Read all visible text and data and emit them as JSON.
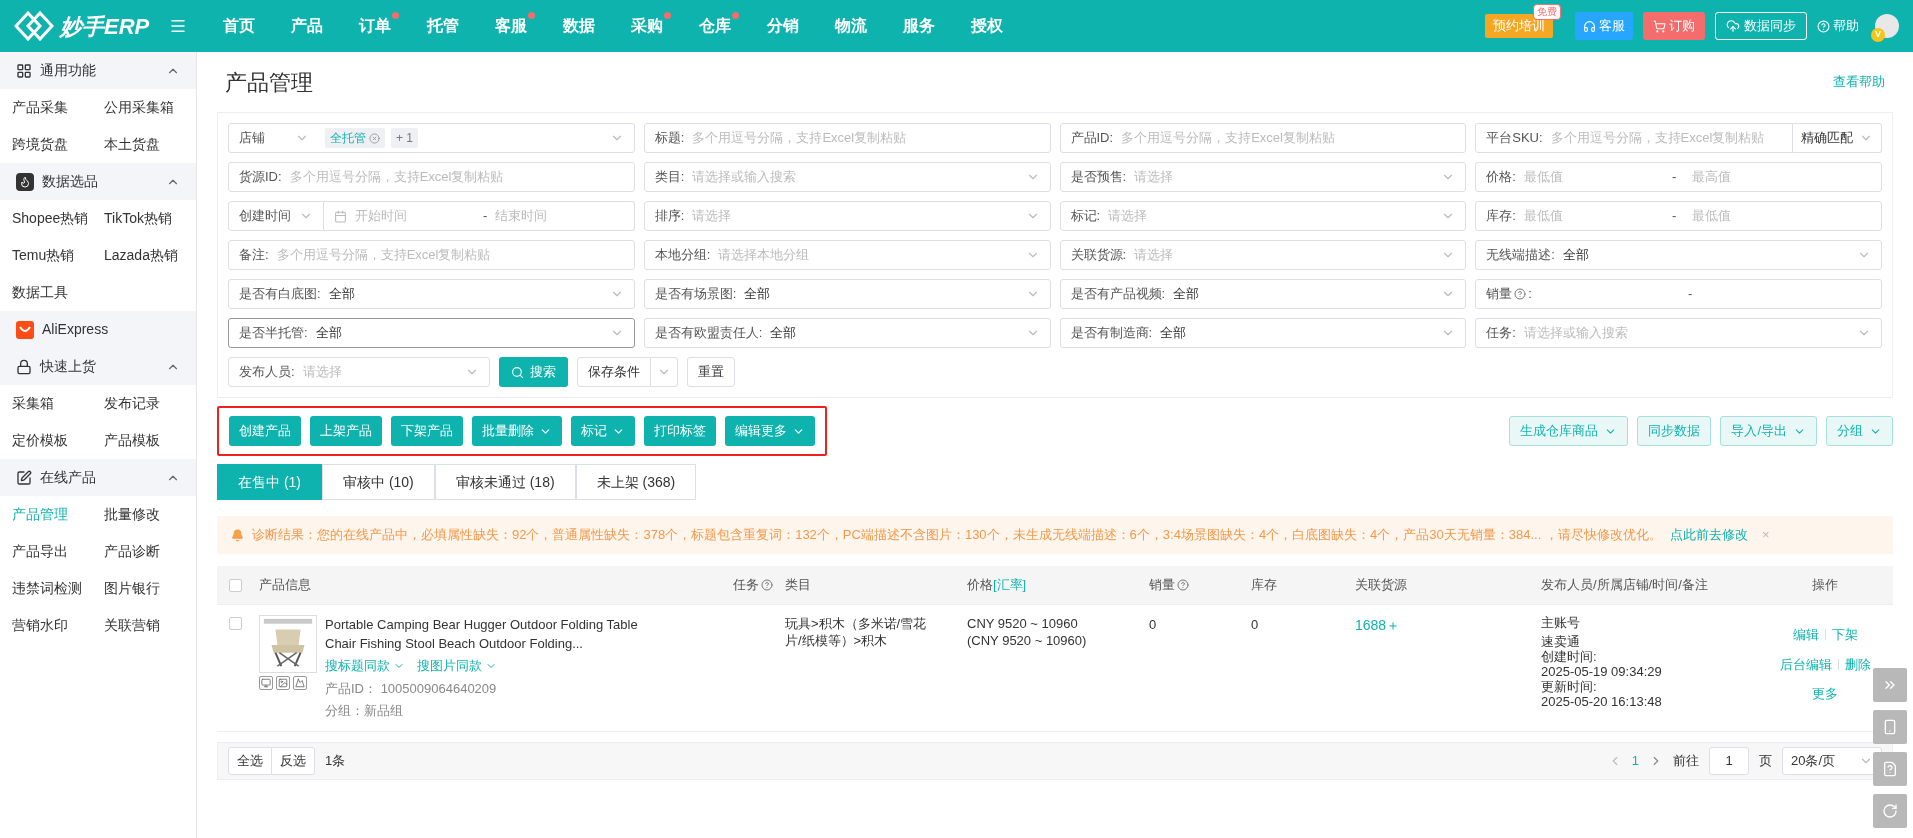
{
  "header": {
    "logo": "妙手ERP",
    "nav": [
      {
        "label": "首页",
        "dot": false
      },
      {
        "label": "产品",
        "dot": false
      },
      {
        "label": "订单",
        "dot": true
      },
      {
        "label": "托管",
        "dot": false
      },
      {
        "label": "客服",
        "dot": true
      },
      {
        "label": "数据",
        "dot": false
      },
      {
        "label": "采购",
        "dot": true
      },
      {
        "label": "仓库",
        "dot": true
      },
      {
        "label": "分销",
        "dot": false
      },
      {
        "label": "物流",
        "dot": false
      },
      {
        "label": "服务",
        "dot": false
      },
      {
        "label": "授权",
        "dot": false
      }
    ],
    "training": "预约培训",
    "training_badge": "免费",
    "service": "客服",
    "order": "订购",
    "sync": "数据同步",
    "help": "帮助",
    "avatar_badge": "V"
  },
  "sidebar": [
    {
      "kind": "group",
      "title": "通用功能",
      "expanded": true,
      "items": [
        {
          "label": "产品采集",
          "selected": false
        },
        {
          "label": "公用采集箱",
          "selected": false
        },
        {
          "label": "跨境货盘",
          "selected": false
        },
        {
          "label": "本土货盘",
          "selected": false
        }
      ]
    },
    {
      "kind": "group",
      "title": "数据选品",
      "expanded": true,
      "items": [
        {
          "label": "Shopee热销",
          "selected": false
        },
        {
          "label": "TikTok热销",
          "selected": false
        },
        {
          "label": "Temu热销",
          "selected": false
        },
        {
          "label": "Lazada热销",
          "selected": false
        },
        {
          "label": "数据工具",
          "selected": false
        }
      ]
    },
    {
      "kind": "link",
      "title": "AliExpress"
    },
    {
      "kind": "group",
      "title": "快速上货",
      "expanded": true,
      "items": [
        {
          "label": "采集箱",
          "selected": false
        },
        {
          "label": "发布记录",
          "selected": false
        },
        {
          "label": "定价模板",
          "selected": false
        },
        {
          "label": "产品模板",
          "selected": false
        }
      ]
    },
    {
      "kind": "group",
      "title": "在线产品",
      "expanded": true,
      "items": [
        {
          "label": "产品管理",
          "selected": true
        },
        {
          "label": "批量修改",
          "selected": false
        },
        {
          "label": "产品导出",
          "selected": false
        },
        {
          "label": "产品诊断",
          "selected": false
        },
        {
          "label": "违禁词检测",
          "selected": false
        },
        {
          "label": "图片银行",
          "selected": false
        },
        {
          "label": "营销水印",
          "selected": false
        },
        {
          "label": "关联营销",
          "selected": false
        }
      ]
    }
  ],
  "page": {
    "title": "产品管理",
    "help_link": "查看帮助"
  },
  "filters": [
    [
      {
        "kind": "tags",
        "label": "店铺",
        "tags": [
          "全托管",
          "+ 1"
        ]
      },
      {
        "kind": "input",
        "label": "标题:",
        "placeholder": "多个用逗号分隔，支持Excel复制粘贴"
      },
      {
        "kind": "input",
        "label": "产品ID:",
        "placeholder": "多个用逗号分隔，支持Excel复制粘贴"
      },
      {
        "kind": "input-match",
        "label": "平台SKU:",
        "placeholder": "多个用逗号分隔，支持Excel复制粘贴",
        "match": "精确匹配"
      }
    ],
    [
      {
        "kind": "input",
        "label": "货源ID:",
        "placeholder": "多个用逗号分隔，支持Excel复制粘贴"
      },
      {
        "kind": "select",
        "label": "类目:",
        "placeholder": "请选择或输入搜索"
      },
      {
        "kind": "select",
        "label": "是否预售:",
        "placeholder": "请选择"
      },
      {
        "kind": "range",
        "label": "价格:",
        "from_placeholder": "最低值",
        "sep": "-",
        "to_placeholder": "最高值"
      }
    ],
    [
      {
        "kind": "daterange",
        "label": "创建时间",
        "start_placeholder": "开始时间",
        "sep": "-",
        "end_placeholder": "结束时间"
      },
      {
        "kind": "select",
        "label": "排序:",
        "placeholder": "请选择"
      },
      {
        "kind": "select",
        "label": "标记:",
        "placeholder": "请选择"
      },
      {
        "kind": "range",
        "label": "库存:",
        "from_placeholder": "最低值",
        "sep": "-",
        "to_placeholder": "最低值"
      }
    ],
    [
      {
        "kind": "input",
        "label": "备注:",
        "placeholder": "多个用逗号分隔，支持Excel复制粘贴"
      },
      {
        "kind": "select",
        "label": "本地分组:",
        "placeholder": "请选择本地分组"
      },
      {
        "kind": "select",
        "label": "关联货源:",
        "placeholder": "请选择"
      },
      {
        "kind": "select",
        "label": "无线端描述:",
        "value": "全部"
      }
    ],
    [
      {
        "kind": "select",
        "label": "是否有白底图:",
        "value": "全部"
      },
      {
        "kind": "select",
        "label": "是否有场景图:",
        "value": "全部"
      },
      {
        "kind": "select",
        "label": "是否有产品视频:",
        "value": "全部"
      },
      {
        "kind": "range",
        "label": "销量",
        "help": true,
        "label_end": ":",
        "sep": "-"
      }
    ],
    [
      {
        "kind": "select",
        "label": "是否半托管:",
        "value": "全部",
        "focused": true
      },
      {
        "kind": "select",
        "label": "是否有欧盟责任人:",
        "value": "全部"
      },
      {
        "kind": "select",
        "label": "是否有制造商:",
        "value": "全部"
      },
      {
        "kind": "select",
        "label": "任务:",
        "placeholder": "请选择或输入搜索"
      }
    ]
  ],
  "filter_actions": {
    "publisher": {
      "label": "发布人员:",
      "placeholder": "请选择"
    },
    "search": "搜索",
    "save": "保存条件",
    "reset": "重置"
  },
  "actions": {
    "highlighted": true,
    "left": [
      {
        "label": "创建产品",
        "dropdown": false
      },
      {
        "label": "上架产品",
        "dropdown": false
      },
      {
        "label": "下架产品",
        "dropdown": false
      },
      {
        "label": "批量删除",
        "dropdown": true
      },
      {
        "label": "标记",
        "dropdown": true
      },
      {
        "label": "打印标签",
        "dropdown": false
      },
      {
        "label": "编辑更多",
        "dropdown": true
      }
    ],
    "right": [
      {
        "label": "生成仓库商品",
        "dropdown": true
      },
      {
        "label": "同步数据",
        "dropdown": false
      },
      {
        "label": "导入/导出",
        "dropdown": true
      },
      {
        "label": "分组",
        "dropdown": true
      }
    ]
  },
  "tabs": [
    {
      "label": "在售中 (1)",
      "selected": true
    },
    {
      "label": "审核中 (10)",
      "selected": false
    },
    {
      "label": "审核未通过 (18)",
      "selected": false
    },
    {
      "label": "未上架 (368)",
      "selected": false
    }
  ],
  "notice": {
    "text": "诊断结果：您的在线产品中，必填属性缺失：92个，普通属性缺失：378个，标题包含重复词：132个，PC端描述不含图片：130个，未生成无线端描述：6个，3:4场景图缺失：4个，白底图缺失：4个，产品30天无销量：384... ，请尽快修改优化。",
    "link": "点此前去修改",
    "close": "×"
  },
  "table": {
    "all_checked": false,
    "columns": [
      {
        "label": "产品信息",
        "help": false
      },
      {
        "label": "任务",
        "help": true
      },
      {
        "label": "类目",
        "help": false
      },
      {
        "label": "价格",
        "link": "[汇率]",
        "help": false
      },
      {
        "label": "销量",
        "help": true
      },
      {
        "label": "库存",
        "help": false
      },
      {
        "label": "关联货源",
        "help": false
      },
      {
        "label": "发布人员/所属店铺/时间/备注",
        "help": false
      },
      {
        "label": "操作",
        "help": false
      }
    ],
    "rows": [
      {
        "checked": false,
        "title": "Portable Camping Bear Hugger Outdoor Folding Table Chair Fishing Stool Beach Outdoor Folding...",
        "search_links": [
          "搜标题同款",
          "搜图片同款"
        ],
        "product_id_label": "产品ID：",
        "product_id": "1005009064640209",
        "group": "分组：新品组",
        "category": "玩具>积木（多米诺/雪花片/纸模等）>积木",
        "price": "CNY 9520 ~ 10960",
        "price_alt": "(CNY 9520 ~ 10960)",
        "sales": "0",
        "stock": "0",
        "source": "1688＋",
        "publisher": "主账号",
        "store": "速卖通",
        "created_label": "创建时间:",
        "created": "2025-05-19 09:34:29",
        "updated_label": "更新时间:",
        "updated": "2025-05-20 16:13:48",
        "ops": [
          [
            "编辑",
            "下架"
          ],
          [
            "后台编辑",
            "删除"
          ],
          [
            "更多"
          ]
        ]
      }
    ]
  },
  "footer": {
    "select_all": "全选",
    "invert": "反选",
    "count": "1条",
    "pages": [
      {
        "label": "1",
        "selected": true
      }
    ],
    "goto": "前往",
    "goto_value": "1",
    "page_unit": "页",
    "page_size": "20条/页"
  }
}
